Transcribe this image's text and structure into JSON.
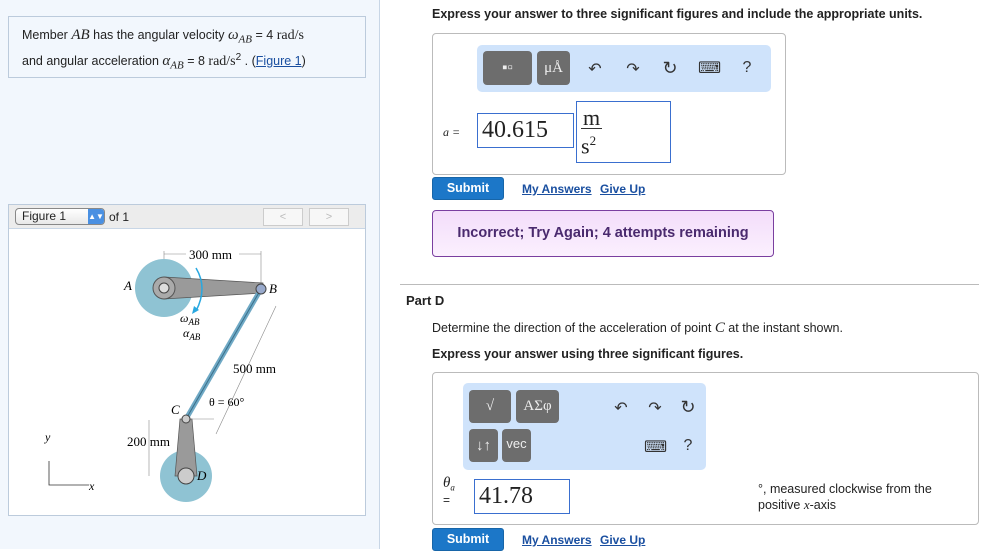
{
  "problem": {
    "text_1": "Member ",
    "ab": "AB",
    "text_2": " has the angular velocity ",
    "omega": "ω",
    "omega_sub": "AB",
    "omega_val": "= 4",
    "omega_unit": "rad/s",
    "text_3": "and angular acceleration ",
    "alpha": "α",
    "alpha_sub": "AB",
    "alpha_val": "= 8",
    "alpha_unit": "rad/s",
    "alpha_exp": "2",
    "text_4": " . (",
    "figure_link": "Figure 1",
    "text_5": ")"
  },
  "figure": {
    "select": "Figure 1",
    "of": "of 1",
    "prev": "<",
    "next": ">",
    "labels": {
      "dim_ab": "300 mm",
      "A": "A",
      "B": "B",
      "C": "C",
      "D": "D",
      "omega": "ω",
      "alpha": "α",
      "sub": "AB",
      "dim_bc": "500 mm",
      "theta": "θ = 60°",
      "dim_cd": "200 mm",
      "y": "y",
      "x": "x"
    }
  },
  "partC": {
    "instruction": "Express your answer to three significant figures and include the appropriate units.",
    "toolbar": {
      "templates": "▪▫",
      "units": "μÅ",
      "undo": "↶",
      "redo": "↷",
      "reset": "↻",
      "keyboard": "⌨",
      "help": "?"
    },
    "label": "a =",
    "value": "40.615",
    "unit_num": "m",
    "unit_den": "s",
    "unit_exp": "2",
    "submit": "Submit",
    "my_answers": "My Answers",
    "give_up": "Give Up",
    "feedback": "Incorrect; Try Again; 4 attempts remaining"
  },
  "partD": {
    "title": "Part D",
    "question_1": "Determine the direction of the acceleration of point ",
    "point": "C",
    "question_2": " at the instant shown.",
    "instruction": "Express your answer using three significant figures.",
    "toolbar": {
      "templates": "√",
      "greek": "ΑΣφ",
      "arrows": "↓↑",
      "vec": "vec",
      "undo": "↶",
      "redo": "↷",
      "reset": "↻",
      "keyboard": "⌨",
      "help": "?"
    },
    "label": "θ",
    "label_sub": "a",
    "label_eq": "=",
    "value": "41.78",
    "unit_1": "°, measured clockwise from the",
    "unit_2": "positive ",
    "unit_x": "x",
    "unit_3": "-axis",
    "submit": "Submit",
    "my_answers": "My Answers",
    "give_up": "Give Up"
  }
}
